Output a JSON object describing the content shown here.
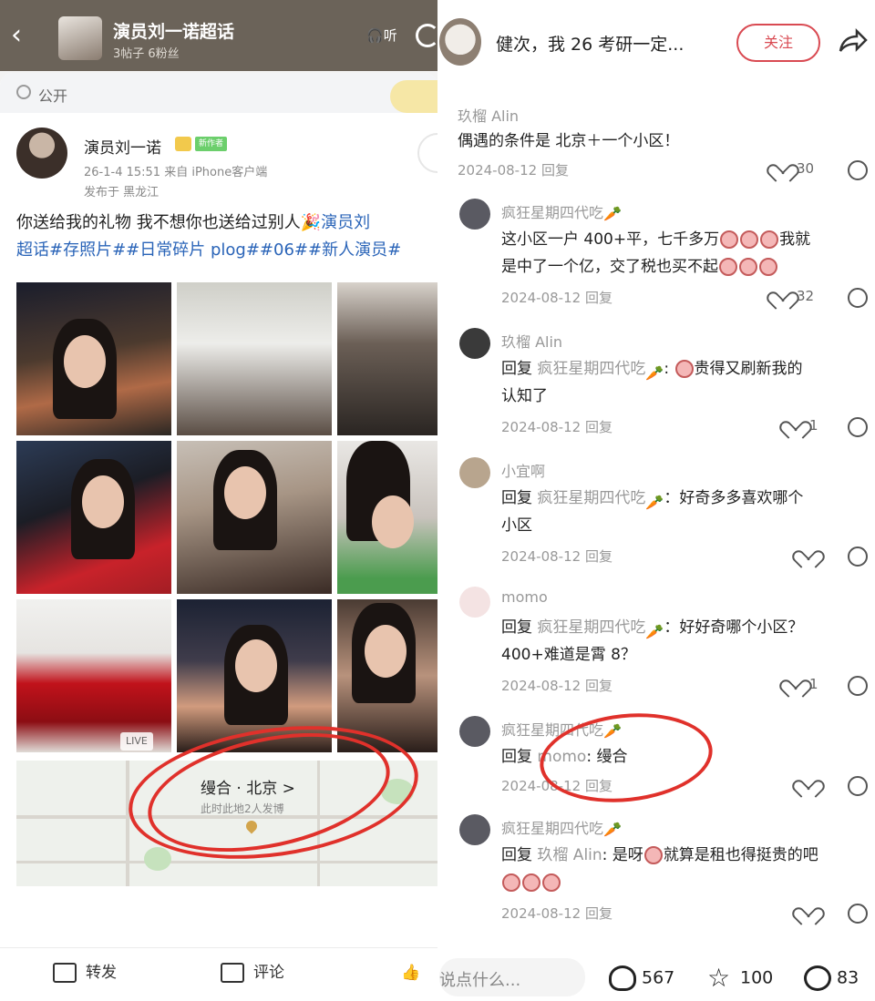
{
  "left": {
    "topbar": {
      "title": "演员刘一诺超话",
      "subtitle": "3帖子 6粉丝",
      "listen_label": "听"
    },
    "privacy": "公开",
    "post": {
      "author": "演员刘一诺",
      "tag": "新作者",
      "time": "26-1-4 15:51 来自 iPhone客户端",
      "location_meta": "发布于 黑龙江",
      "text_line1": "你送给我的礼物 我不想你也送给过别人",
      "text_line1_link": "演员刘",
      "text_line2": "超话#存照片##日常碎片 plog##06##新人演员#",
      "live_label": "LIVE"
    },
    "map": {
      "location": "缦合 · 北京 >",
      "sub": "此时此地2人发博"
    },
    "footer": {
      "forward": "转发",
      "comment": "评论"
    }
  },
  "right": {
    "header": {
      "title": "健次，我 26 考研一定...",
      "follow": "关注"
    },
    "comments": [
      {
        "name": "玖榴 Alin",
        "text": "偶遇的条件是  北京＋一个小区！",
        "date": "2024-08-12 回复",
        "likes": "30"
      },
      {
        "name": "疯狂星期四代吃",
        "text1": "这小区一户 400+平，七千多万",
        "text1_tail": "我就",
        "text2": "是中了一个亿，交了税也买不起",
        "date": "2024-08-12 回复",
        "likes": "32"
      },
      {
        "name": "玖榴 Alin",
        "reply_prefix": "回复",
        "reply_to": "疯狂星期四代吃",
        "text1": "贵得又刷新我的",
        "text2": "认知了",
        "date": "2024-08-12 回复",
        "likes": "1"
      },
      {
        "name": "小宜啊",
        "reply_prefix": "回复",
        "reply_to": "疯狂星期四代吃",
        "text1": "：好奇多多喜欢哪个",
        "text2": "小区",
        "date": "2024-08-12 回复",
        "likes": ""
      },
      {
        "name": "momo",
        "reply_prefix": "回复",
        "reply_to": "疯狂星期四代吃",
        "text1": "：好好奇哪个小区？",
        "text2": "400+难道是霄 8？",
        "date": "2024-08-12 回复",
        "likes": "1"
      },
      {
        "name": "疯狂星期四代吃",
        "reply_prefix": "回复",
        "reply_to": "momo",
        "text1": ": 缦合",
        "date": "2024-08-12 回复",
        "likes": ""
      },
      {
        "name": "疯狂星期四代吃",
        "reply_prefix": "回复",
        "reply_to": "玖榴 Alin",
        "text1": ": 是呀",
        "text1_tail": "就算是租也得挺贵的吧",
        "date": "2024-08-12 回复",
        "likes": ""
      }
    ],
    "footer": {
      "input_placeholder": "说点什么...",
      "likes": "567",
      "stars": "100",
      "comments": "83"
    }
  }
}
